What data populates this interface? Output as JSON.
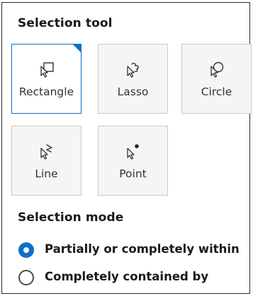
{
  "selection_tool": {
    "title": "Selection tool",
    "tools": [
      {
        "label": "Rectangle",
        "icon": "rectangle-select-icon",
        "selected": true
      },
      {
        "label": "Lasso",
        "icon": "lasso-select-icon",
        "selected": false
      },
      {
        "label": "Circle",
        "icon": "circle-select-icon",
        "selected": false
      },
      {
        "label": "Line",
        "icon": "line-select-icon",
        "selected": false
      },
      {
        "label": "Point",
        "icon": "point-select-icon",
        "selected": false
      }
    ]
  },
  "selection_mode": {
    "title": "Selection mode",
    "options": [
      {
        "label": "Partially or completely within",
        "checked": true
      },
      {
        "label": "Completely contained by",
        "checked": false
      }
    ]
  },
  "colors": {
    "accent": "#0f6fc6",
    "tile_background": "#f5f5f5",
    "tile_border": "#c9c9c9"
  }
}
